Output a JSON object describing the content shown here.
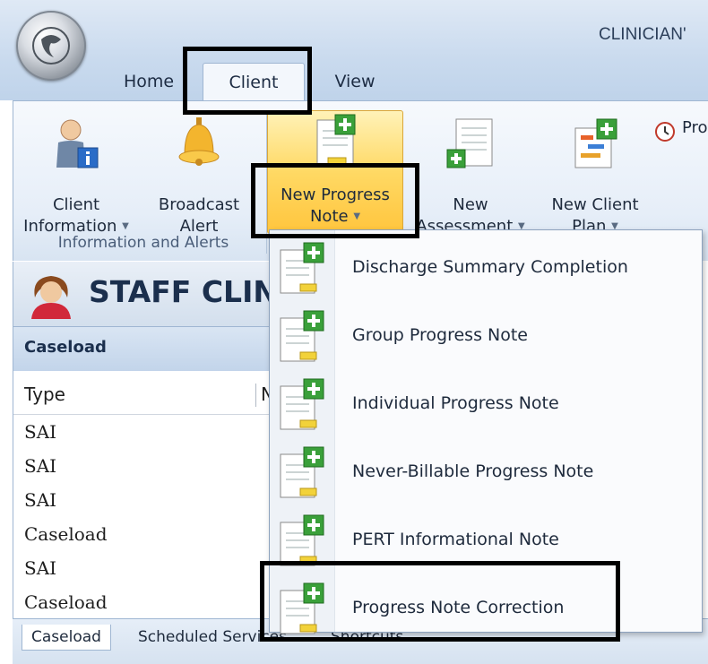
{
  "app": {
    "title_fragment": "CLINICIAN'"
  },
  "tabs": {
    "home": "Home",
    "client": "Client",
    "view": "View"
  },
  "ribbon": {
    "client_info": {
      "line1": "Client",
      "line2": "Information"
    },
    "broadcast": {
      "line1": "Broadcast",
      "line2": "Alert"
    },
    "new_progress": {
      "line1": "New Progress",
      "line2": "Note"
    },
    "new_assessment": {
      "line1": "New",
      "line2": "Assessment"
    },
    "new_client_plan": {
      "line1": "New Client",
      "line2": "Plan"
    },
    "pro": "Pro",
    "group_label": "Information and Alerts"
  },
  "staff": {
    "name": "STAFF CLIN"
  },
  "caseload": {
    "title": "Caseload",
    "columns": {
      "type": "Type",
      "n": "N"
    },
    "rows": [
      "SAI",
      "SAI",
      "SAI",
      "Caseload",
      "SAI",
      "Caseload"
    ]
  },
  "bottom_tabs": {
    "caseload": "Caseload",
    "scheduled": "Scheduled Services",
    "shortcuts": "Shortcuts"
  },
  "menu": {
    "items": [
      "Discharge Summary Completion",
      "Group Progress Note",
      "Individual Progress Note",
      "Never-Billable Progress Note",
      "PERT Informational Note",
      "Progress Note Correction"
    ]
  }
}
